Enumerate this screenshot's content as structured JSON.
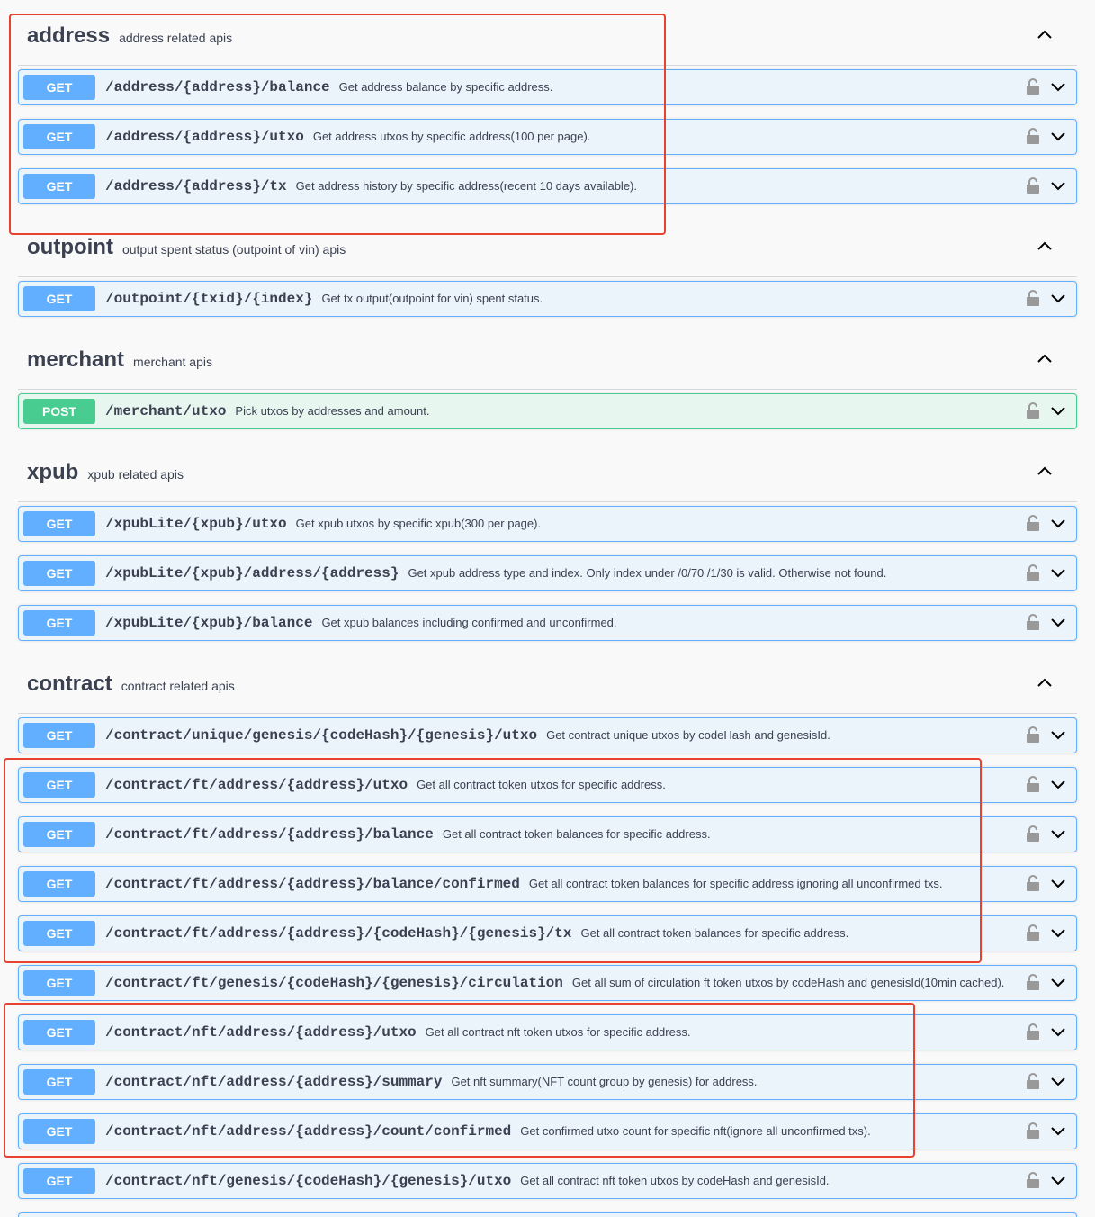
{
  "sections": [
    {
      "name": "address",
      "description": "address related apis"
    },
    {
      "name": "outpoint",
      "description": "output spent status (outpoint of vin) apis"
    },
    {
      "name": "merchant",
      "description": "merchant apis"
    },
    {
      "name": "xpub",
      "description": "xpub related apis"
    },
    {
      "name": "contract",
      "description": "contract related apis"
    }
  ],
  "operations": [
    {
      "method": "GET",
      "path": "/address/{address}/balance",
      "summary": "Get address balance by specific address."
    },
    {
      "method": "GET",
      "path": "/address/{address}/utxo",
      "summary": "Get address utxos by specific address(100 per page)."
    },
    {
      "method": "GET",
      "path": "/address/{address}/tx",
      "summary": "Get address history by specific address(recent 10 days available)."
    },
    {
      "method": "GET",
      "path": "/outpoint/{txid}/{index}",
      "summary": "Get tx output(outpoint for vin) spent status."
    },
    {
      "method": "POST",
      "path": "/merchant/utxo",
      "summary": "Pick utxos by addresses and amount."
    },
    {
      "method": "GET",
      "path": "/xpubLite/{xpub}/utxo",
      "summary": "Get xpub utxos by specific xpub(300 per page)."
    },
    {
      "method": "GET",
      "path": "/xpubLite/{xpub}/address/{address}",
      "summary": "Get xpub address type and index. Only index under /0/70 /1/30 is valid. Otherwise not found."
    },
    {
      "method": "GET",
      "path": "/xpubLite/{xpub}/balance",
      "summary": "Get xpub balances including confirmed and unconfirmed."
    },
    {
      "method": "GET",
      "path": "/contract/unique/genesis/{codeHash}/{genesis}/utxo",
      "summary": "Get contract unique utxos by codeHash and genesisId."
    },
    {
      "method": "GET",
      "path": "/contract/ft/address/{address}/utxo",
      "summary": "Get all contract token utxos for specific address."
    },
    {
      "method": "GET",
      "path": "/contract/ft/address/{address}/balance",
      "summary": "Get all contract token balances for specific address."
    },
    {
      "method": "GET",
      "path": "/contract/ft/address/{address}/balance/confirmed",
      "summary": "Get all contract token balances for specific address ignoring all unconfirmed txs."
    },
    {
      "method": "GET",
      "path": "/contract/ft/address/{address}/{codeHash}/{genesis}/tx",
      "summary": "Get all contract token balances for specific address."
    },
    {
      "method": "GET",
      "path": "/contract/ft/genesis/{codeHash}/{genesis}/circulation",
      "summary": "Get all sum of circulation ft token utxos by codeHash and genesisId(10min cached)."
    },
    {
      "method": "GET",
      "path": "/contract/nft/address/{address}/utxo",
      "summary": "Get all contract nft token utxos for specific address."
    },
    {
      "method": "GET",
      "path": "/contract/nft/address/{address}/summary",
      "summary": "Get nft summary(NFT count group by genesis) for address."
    },
    {
      "method": "GET",
      "path": "/contract/nft/address/{address}/count/confirmed",
      "summary": "Get confirmed utxo count for specific nft(ignore all unconfirmed txs)."
    },
    {
      "method": "GET",
      "path": "/contract/nft/genesis/{codeHash}/{genesis}/utxo",
      "summary": "Get all contract nft token utxos by codeHash and genesisId."
    }
  ],
  "colors": {
    "get": "#61affe",
    "post": "#49cc90",
    "highlight": "#e8412f"
  },
  "icons": {
    "lock": "unlocked-padlock-icon",
    "expand": "chevron-down-icon",
    "collapse": "chevron-up-icon"
  }
}
